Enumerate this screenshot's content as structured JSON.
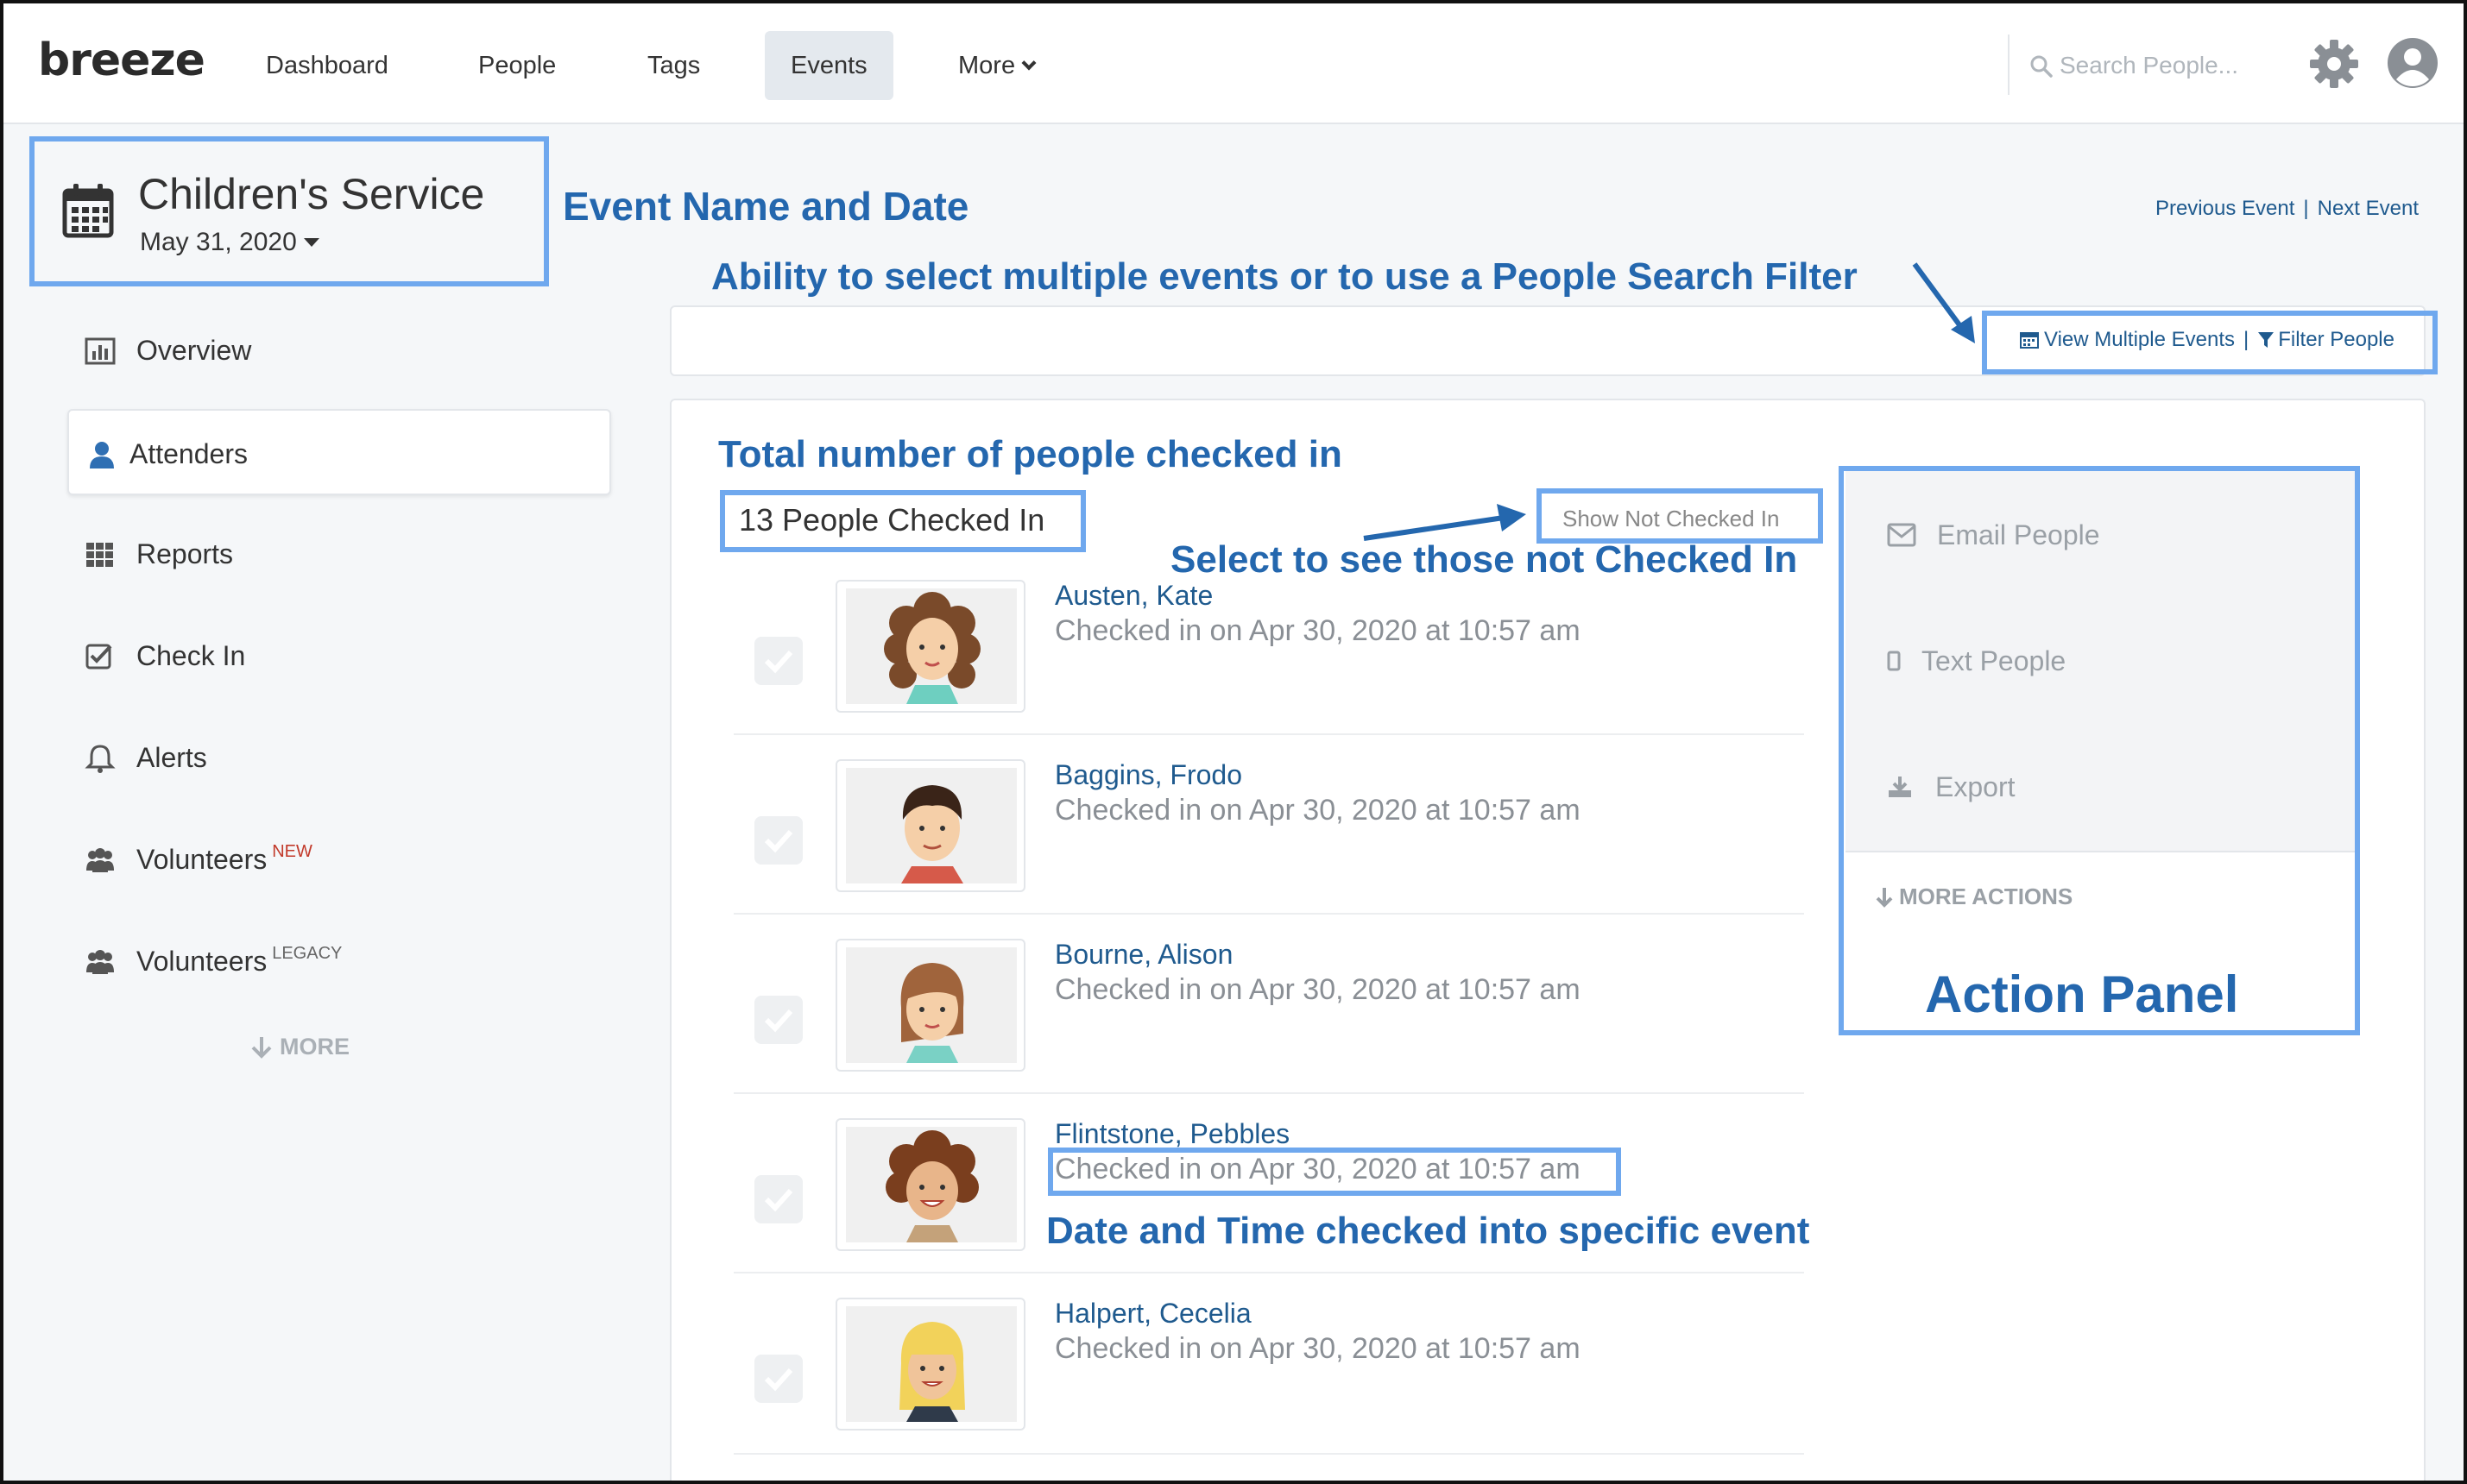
{
  "nav": {
    "logo": "breeze",
    "items": [
      {
        "label": "Dashboard"
      },
      {
        "label": "People"
      },
      {
        "label": "Tags"
      },
      {
        "label": "Events"
      },
      {
        "label": "More"
      }
    ],
    "active": "Events",
    "search_placeholder": "Search People...",
    "icons": [
      "search-icon",
      "gear-icon",
      "user-avatar-icon"
    ]
  },
  "event": {
    "title": "Children's Service",
    "date": "May 31, 2020",
    "prev_link": "Previous Event",
    "next_link": "Next Event",
    "separator": "|"
  },
  "sidebar": {
    "items": [
      {
        "label": "Overview",
        "icon": "bar-chart-icon"
      },
      {
        "label": "Attenders",
        "icon": "person-icon",
        "active": true
      },
      {
        "label": "Reports",
        "icon": "grid-icon"
      },
      {
        "label": "Check In",
        "icon": "checkbox-icon"
      },
      {
        "label": "Alerts",
        "icon": "bell-icon"
      },
      {
        "label": "Volunteers",
        "badge": "NEW",
        "icon": "group-icon"
      },
      {
        "label": "Volunteers",
        "badge": "LEGACY",
        "icon": "group-icon"
      }
    ],
    "more": "MORE"
  },
  "filters": {
    "view_multiple": "View Multiple Events",
    "filter_people": "Filter People",
    "separator": "|"
  },
  "attendance": {
    "count_text": "13 People Checked In",
    "show_not_checked": "Show Not Checked In",
    "people": [
      {
        "name": "Austen, Kate",
        "checked_in": "Checked in on Apr 30, 2020 at 10:57 am"
      },
      {
        "name": "Baggins, Frodo",
        "checked_in": "Checked in on Apr 30, 2020 at 10:57 am"
      },
      {
        "name": "Bourne, Alison",
        "checked_in": "Checked in on Apr 30, 2020 at 10:57 am"
      },
      {
        "name": "Flintstone, Pebbles",
        "checked_in": "Checked in on Apr 30, 2020 at 10:57 am"
      },
      {
        "name": "Halpert, Cecelia",
        "checked_in": "Checked in on Apr 30, 2020 at 10:57 am"
      }
    ]
  },
  "actions": {
    "email": "Email People",
    "text": "Text People",
    "export": "Export",
    "more": "MORE ACTIONS"
  },
  "annotations": {
    "event_name_date": "Event Name and Date",
    "multiple_events": "Ability to select multiple events or to use a People Search Filter",
    "total_checked": "Total number of people checked in",
    "not_checked": "Select to see those not Checked In",
    "date_time": "Date and Time checked into specific event",
    "action_panel": "Action Panel",
    "color": "#2467ae",
    "box_color": "#6fa8ee"
  }
}
